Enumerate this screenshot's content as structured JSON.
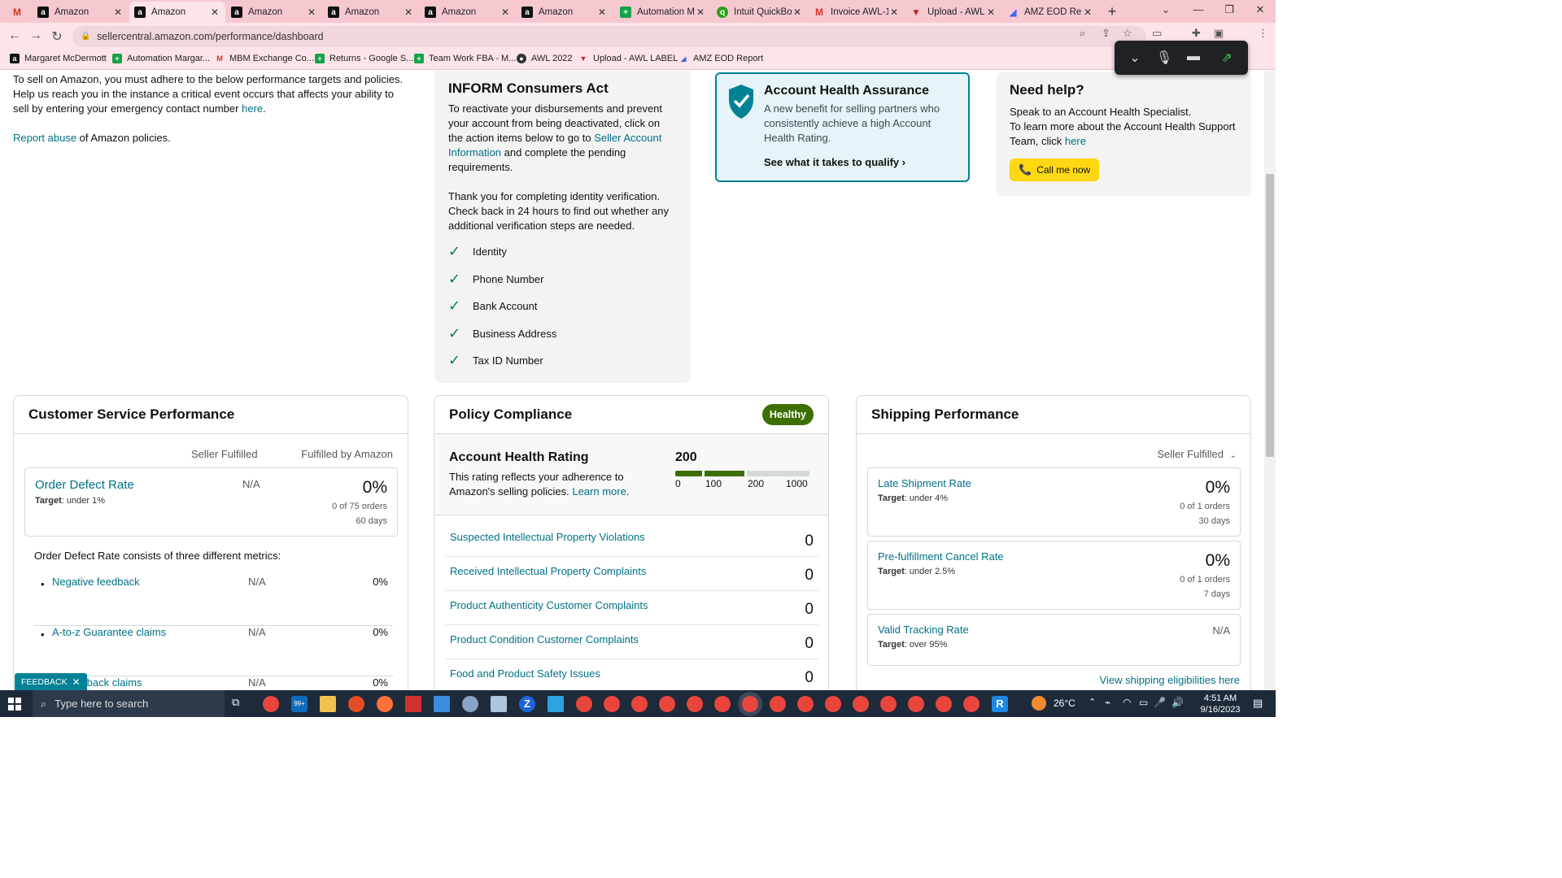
{
  "browser": {
    "tabs": [
      {
        "label": "",
        "icon": "gmail-icon"
      },
      {
        "label": "Amazon",
        "icon": "amazon-icon"
      },
      {
        "label": "Amazon",
        "icon": "amazon-icon"
      },
      {
        "label": "Amazon",
        "icon": "amazon-icon"
      },
      {
        "label": "Amazon",
        "icon": "amazon-icon"
      },
      {
        "label": "Amazon",
        "icon": "amazon-icon"
      },
      {
        "label": "Amazon",
        "icon": "amazon-icon"
      },
      {
        "label": "Automation M",
        "icon": "sheets-icon"
      },
      {
        "label": "Intuit QuickBo",
        "icon": "quickbooks-icon"
      },
      {
        "label": "Invoice AWL-1",
        "icon": "gmail-icon"
      },
      {
        "label": "Upload - AWL",
        "icon": "upload-icon"
      },
      {
        "label": "AMZ EOD Rep",
        "icon": "eod-icon"
      }
    ],
    "url": "sellercentral.amazon.com/performance/dashboard",
    "bookmarks": [
      {
        "label": "Margaret McDermott",
        "icon": "amazon-icon"
      },
      {
        "label": "Automation Margar...",
        "icon": "sheets-icon"
      },
      {
        "label": "MBM Exchange Co...",
        "icon": "gmail-icon"
      },
      {
        "label": "Returns - Google S...",
        "icon": "sheets-icon"
      },
      {
        "label": "Team Work FBA - M...",
        "icon": "sheets-icon"
      },
      {
        "label": "AWL 2022",
        "icon": "globe-icon"
      },
      {
        "label": "Upload - AWL LABEL",
        "icon": "upload-icon"
      },
      {
        "label": "AMZ EOD Report",
        "icon": "eod-icon"
      }
    ]
  },
  "intro": {
    "text1": "To sell on Amazon, you must adhere to the below performance targets and policies. Help us reach you in the instance a critical event occurs that affects your ability to sell by entering your emergency contact number",
    "here_link": "here",
    "period": ".",
    "report_link": "Report abuse",
    "report_rest": " of Amazon policies."
  },
  "inform": {
    "title": "INFORM Consumers Act",
    "p1_start": "To reactivate your disbursements and prevent your account from being deactivated, click on the action items below to go to",
    "p1_link": "Seller Account Information",
    "p1_end": "and complete the pending requirements.",
    "p2": "Thank you for completing identity verification. Check back in 24 hours to find out whether any additional verification steps are needed.",
    "items": [
      "Identity",
      "Phone Number",
      "Bank Account",
      "Business Address",
      "Tax ID Number"
    ]
  },
  "aha": {
    "title": "Account Health Assurance",
    "desc": "A new benefit for selling partners who consistently achieve a high Account Health Rating.",
    "link": "See what it takes to qualify"
  },
  "help": {
    "title": "Need help?",
    "line1": "Speak to an Account Health Specialist.",
    "line2": "To learn more about the Account Health Support Team, click",
    "link": "here",
    "button": "Call me now"
  },
  "customer_service": {
    "title": "Customer Service Performance",
    "col1": "Seller Fulfilled",
    "col2": "Fulfilled by Amazon",
    "odr": {
      "name": "Order Defect Rate",
      "target_label": "Target",
      "target_value": ": under 1%",
      "seller": "N/A",
      "fba": "0%",
      "orders": "0 of 75 orders",
      "days": "60 days"
    },
    "consists": "Order Defect Rate consists of three different metrics:",
    "metrics": [
      {
        "name": "Negative feedback",
        "seller": "N/A",
        "fba": "0%"
      },
      {
        "name": "A-to-z Guarantee claims",
        "seller": "N/A",
        "fba": "0%"
      },
      {
        "name": "Chargeback claims",
        "seller": "N/A",
        "fba": "0%"
      }
    ]
  },
  "policy": {
    "title": "Policy Compliance",
    "status": "Healthy",
    "rating_title": "Account Health Rating",
    "rating_desc": "This rating reflects your adherence to Amazon's selling policies.",
    "learn_more": "Learn more",
    "score": "200",
    "ticks": [
      "0",
      "100",
      "200",
      "1000"
    ],
    "rows": [
      {
        "name": "Suspected Intellectual Property Violations",
        "value": "0"
      },
      {
        "name": "Received Intellectual Property Complaints",
        "value": "0"
      },
      {
        "name": "Product Authenticity Customer Complaints",
        "value": "0"
      },
      {
        "name": "Product Condition Customer Complaints",
        "value": "0"
      },
      {
        "name": "Food and Product Safety Issues",
        "value": "0"
      }
    ]
  },
  "shipping": {
    "title": "Shipping Performance",
    "selector": "Seller Fulfilled",
    "metrics": [
      {
        "name": "Late Shipment Rate",
        "target_label": "Target",
        "target_value": ": under 4%",
        "value": "0%",
        "orders": "0 of 1 orders",
        "days": "30 days"
      },
      {
        "name": "Pre-fulfillment Cancel Rate",
        "target_label": "Target",
        "target_value": ": under 2.5%",
        "value": "0%",
        "orders": "0 of 1 orders",
        "days": "7 days"
      },
      {
        "name": "Valid Tracking Rate",
        "target_label": "Target",
        "target_value": ": over 95%",
        "value": "N/A"
      }
    ],
    "link": "View shipping eligibilities here"
  },
  "feedback": "FEEDBACK",
  "taskbar": {
    "search_placeholder": "Type here to search",
    "temperature": "26°C",
    "time": "4:51 AM",
    "date": "9/16/2023",
    "mail_badge": "99+"
  },
  "colors": {
    "link": "#007185",
    "healthy": "#3c6e00",
    "call_button": "#ffd814",
    "tab_bar": "#f6c9d0"
  }
}
